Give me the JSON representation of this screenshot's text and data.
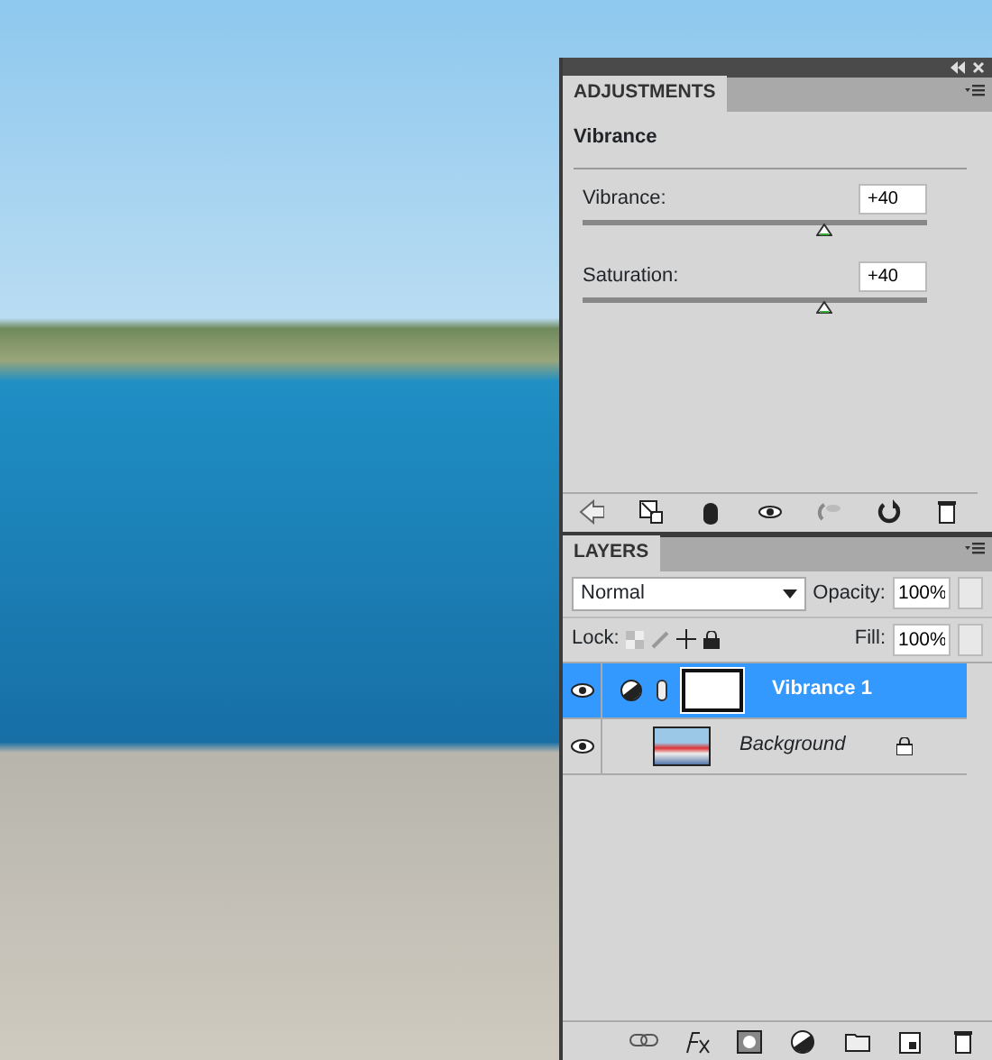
{
  "adjustments_panel": {
    "tab": "ADJUSTMENTS",
    "title": "Vibrance",
    "sliders": [
      {
        "label": "Vibrance:",
        "value": "+40",
        "level": 0.7
      },
      {
        "label": "Saturation:",
        "value": "+40",
        "level": 0.7
      }
    ]
  },
  "layers_panel": {
    "tab": "LAYERS",
    "blend_mode": "Normal",
    "opacity_label": "Opacity:",
    "opacity": "100%",
    "lock_label": "Lock:",
    "fill_label": "Fill:",
    "fill": "100%",
    "layers": [
      {
        "name": "Vibrance 1",
        "kind": "adjustment",
        "selected": true,
        "visible": true,
        "locked": false
      },
      {
        "name": "Background",
        "kind": "image",
        "selected": false,
        "visible": true,
        "locked": true
      }
    ]
  }
}
